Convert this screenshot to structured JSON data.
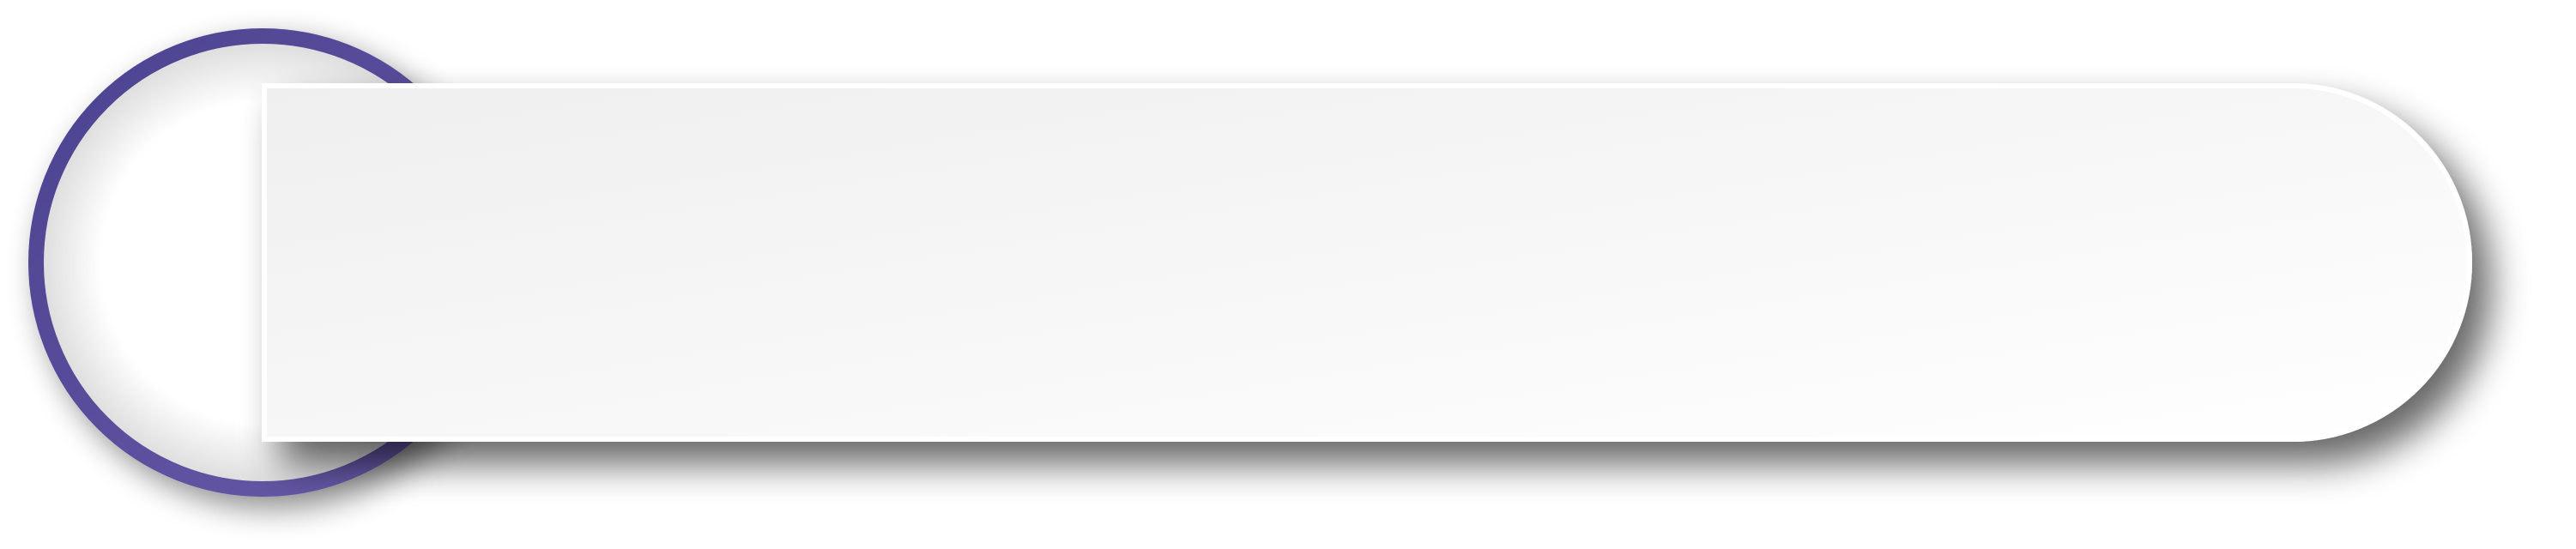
{
  "banner": {
    "text": ""
  },
  "colors": {
    "ring_start": "#4a4290",
    "ring_end": "#6a5aa8",
    "panel_light": "#ffffff",
    "panel_dark": "#efefef",
    "panel_border": "#ffffff"
  },
  "icons": {
    "badge": "circle-ring-icon"
  }
}
